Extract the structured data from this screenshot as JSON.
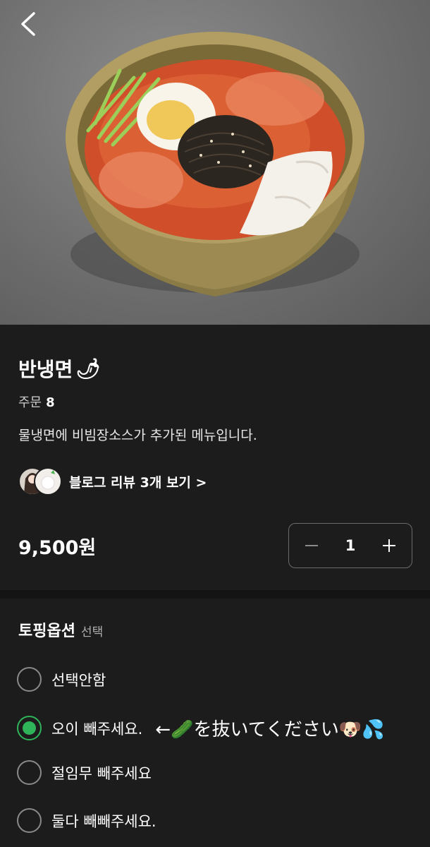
{
  "header": {
    "back_icon": "chevron-left-icon"
  },
  "product": {
    "name": "반냉면",
    "name_emoji": "🌶",
    "order_label": "주문",
    "order_count": "8",
    "description": "물냉면에 비빔장소스가 추가된 메뉴입니다.",
    "review_link": "블로그 리뷰 3개 보기 >",
    "price": "9,500원",
    "quantity": "1"
  },
  "options": {
    "title": "토핑옵션",
    "subtitle": "선택",
    "items": [
      {
        "label": "선택안함",
        "selected": false
      },
      {
        "label": "오이 빼주세요.",
        "selected": true,
        "note": "←🥒を抜いてください🐶💦"
      },
      {
        "label": "절임무 빼주세요",
        "selected": false
      },
      {
        "label": "둘다 빼빼주세요.",
        "selected": false
      }
    ]
  },
  "colors": {
    "accent": "#2fb45a",
    "background": "#1c1c1c"
  }
}
